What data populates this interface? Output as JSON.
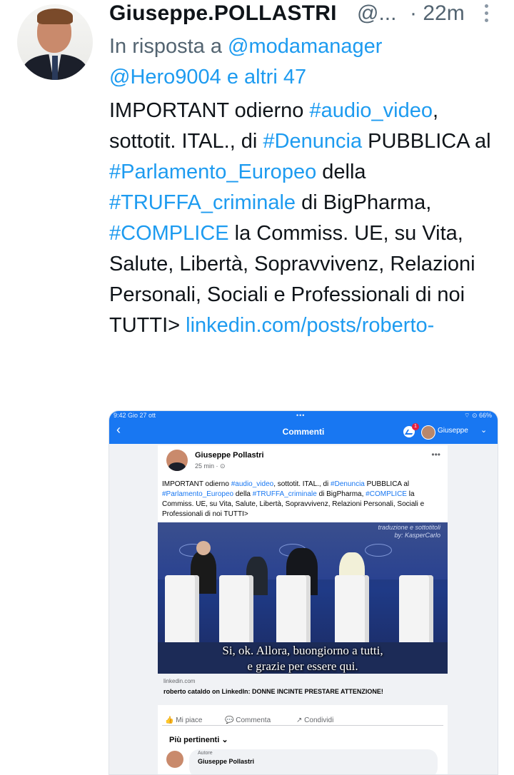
{
  "tweet": {
    "display_name": "Giuseppe.POLLASTRI",
    "handle": "@...",
    "time": "· 22m",
    "reply_prefix": "In risposta a ",
    "reply_mention1": "@modamanager",
    "reply_mention2": "@Hero9004",
    "reply_rest": " e altri 47",
    "body": [
      {
        "t": "IMPORTANT odierno ",
        "tag": false
      },
      {
        "t": "#audio_video",
        "tag": true
      },
      {
        "t": ", sottotit. ITAL., di ",
        "tag": false
      },
      {
        "t": "#Denuncia",
        "tag": true
      },
      {
        "t": " PUBBLICA al ",
        "tag": false
      },
      {
        "t": "#Parlamento_Europeo",
        "tag": true
      },
      {
        "t": " della ",
        "tag": false
      },
      {
        "t": "#TRUFFA_criminale",
        "tag": true
      },
      {
        "t": " di BigPharma, ",
        "tag": false
      },
      {
        "t": "#COMPLICE",
        "tag": true
      },
      {
        "t": " la Commiss. UE, su Vita, Salute, Libertà, Sopravvivenz, Relazioni Personali, Sociali e Professionali di noi TUTTI> ",
        "tag": false
      },
      {
        "t": "linkedin.com/posts/roberto-",
        "tag": true
      }
    ]
  },
  "screenshot": {
    "status_left": "9:42  Gio 27 ott",
    "status_center": "•••",
    "status_right": "⌔ ⊙ 66%",
    "header_title": "Commenti",
    "notification_count": "1",
    "user_label": "Giuseppe",
    "post": {
      "author": "Giuseppe Pollastri",
      "meta": "25 min · ⊙",
      "body": [
        {
          "t": "IMPORTANT odierno ",
          "tag": false
        },
        {
          "t": "#audio_video",
          "tag": true
        },
        {
          "t": ", sottotit. ITAL., di ",
          "tag": false
        },
        {
          "t": "#Denuncia",
          "tag": true
        },
        {
          "t": " PUBBLICA al ",
          "tag": false
        },
        {
          "t": "#Parlamento_Europeo",
          "tag": true
        },
        {
          "t": " della ",
          "tag": false
        },
        {
          "t": "#TRUFFA_criminale",
          "tag": true
        },
        {
          "t": " di BigPharma, ",
          "tag": false
        },
        {
          "t": "#COMPLICE",
          "tag": true
        },
        {
          "t": " la Commiss. UE, su Vita, Salute, Libertà, Sopravvivenz, Relazioni Personali, Sociali e Professionali di noi TUTTI>",
          "tag": false
        }
      ],
      "video_watermark1": "traduzione e sottotitoli",
      "video_watermark2": "by: KasperCarlo",
      "subtitle1": "Si, ok. Allora, buongiorno a tutti,",
      "subtitle2": "e grazie per essere qui.",
      "link_domain": "linkedin.com",
      "link_title": "roberto cataldo on LinkedIn: DONNE INCINTE PRESTARE ATTENZIONE!",
      "like_label": "Mi piace",
      "comment_label": "Commenta",
      "share_label": "Condividi",
      "sort_label": "Più pertinenti ⌄",
      "comment_role": "Autore",
      "comment_author": "Giuseppe Pollastri"
    }
  },
  "colors": {
    "link": "#1d9bf0",
    "fb_blue": "#1877f2",
    "muted": "#536471"
  }
}
